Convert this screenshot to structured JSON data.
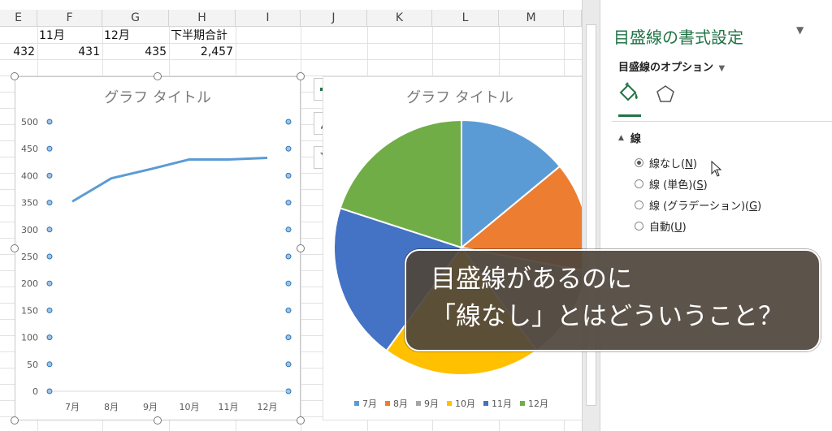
{
  "sheet": {
    "columns": [
      "E",
      "F",
      "G",
      "H",
      "I",
      "J",
      "K",
      "L",
      "M"
    ],
    "header_row": {
      "F": "11月",
      "G": "12月",
      "H": "下半期合計"
    },
    "value_row": {
      "E": "432",
      "F": "431",
      "G": "435",
      "H": "2,457"
    }
  },
  "line_chart": {
    "title": "グラフ タイトル",
    "y_ticks": [
      "500",
      "450",
      "400",
      "350",
      "300",
      "250",
      "200",
      "150",
      "100",
      "50",
      "0"
    ],
    "x_labels": [
      "7月",
      "8月",
      "9月",
      "10月",
      "11月",
      "12月"
    ]
  },
  "pie_chart": {
    "title": "グラフ タイトル",
    "legend": [
      "7月",
      "8月",
      "9月",
      "10月",
      "11月",
      "12月"
    ]
  },
  "chart_data": [
    {
      "type": "line",
      "title": "グラフ タイトル",
      "categories": [
        "7月",
        "8月",
        "9月",
        "10月",
        "11月",
        "12月"
      ],
      "values": [
        352,
        395,
        412,
        430,
        430,
        433
      ],
      "ylim": [
        0,
        500
      ],
      "yticks": [
        0,
        50,
        100,
        150,
        200,
        250,
        300,
        350,
        400,
        450,
        500
      ],
      "color": "#5b9bd5",
      "grid": false
    },
    {
      "type": "pie",
      "title": "グラフ タイトル",
      "labels": [
        "7月",
        "8月",
        "9月",
        "10月",
        "11月",
        "12月"
      ],
      "values": [
        14,
        14,
        12,
        20,
        20,
        20
      ],
      "colors": [
        "#5b9bd5",
        "#ed7d31",
        "#a5a5a5",
        "#ffc000",
        "#4472c4",
        "#70ad47"
      ],
      "legend": "bottom"
    }
  ],
  "pane": {
    "title": "目盛線の書式設定",
    "options_label": "目盛線のオプション",
    "section_label": "線",
    "icons": [
      "fill-line-icon",
      "effects-icon"
    ],
    "radios": [
      {
        "label": "線なし(",
        "key": "N",
        "tail": ")",
        "selected": true
      },
      {
        "label": "線 (単色)(",
        "key": "S",
        "tail": ")",
        "selected": false
      },
      {
        "label": "線 (グラデーション)(",
        "key": "G",
        "tail": ")",
        "selected": false
      },
      {
        "label": "自動(",
        "key": "U",
        "tail": ")",
        "selected": false
      }
    ]
  },
  "caption": {
    "line1": "目盛線があるのに",
    "line2": "「線なし」とはどういうこと？"
  },
  "colors": {
    "accent": "#217346",
    "caption_bg": "#504638"
  }
}
